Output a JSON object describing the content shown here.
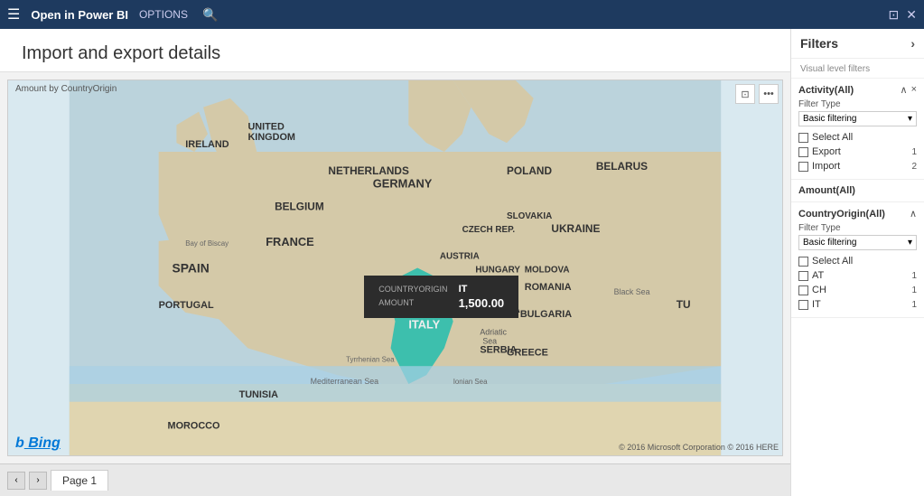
{
  "titleBar": {
    "appName": "Open in Power BI",
    "options": "OPTIONS",
    "searchIcon": "🔍",
    "windowControls": [
      "⊡",
      "×"
    ]
  },
  "pageTitle": "Import and export details",
  "mapLabel": "Amount by CountryOrigin",
  "mapControls": {
    "expandIcon": "⊡",
    "moreIcon": "..."
  },
  "tooltip": {
    "countryOriginLabel": "COUNTRYORIGIN",
    "countryOriginValue": "IT",
    "amountLabel": "AMOUNT",
    "amountValue": "1,500.00"
  },
  "bingLogo": "b̲ Bing",
  "copyright": "© 2016 Microsoft Corporation  © 2016 HERE",
  "pageNav": {
    "prevBtn": "‹",
    "nextBtn": "›",
    "pageTab": "Page 1"
  },
  "filters": {
    "title": "Filters",
    "arrowIcon": "›",
    "visualLevelLabel": "Visual level filters",
    "cards": [
      {
        "id": "activity",
        "title": "Activity(All)",
        "upIcon": "^",
        "closeIcon": "×",
        "filterTypeLabel": "Filter Type",
        "filterTypeValue": "Basic filtering",
        "items": [
          {
            "label": "Select All",
            "count": "",
            "checked": false
          },
          {
            "label": "Export",
            "count": "1",
            "checked": false
          },
          {
            "label": "Import",
            "count": "2",
            "checked": false
          }
        ]
      },
      {
        "id": "amount",
        "title": "Amount(All)",
        "items": []
      },
      {
        "id": "countryOrigin",
        "title": "CountryOrigin(All)",
        "upIcon": "^",
        "filterTypeLabel": "Filter Type",
        "filterTypeValue": "Basic filtering",
        "items": [
          {
            "label": "Select All",
            "count": "",
            "checked": false
          },
          {
            "label": "AT",
            "count": "1",
            "checked": false
          },
          {
            "label": "CH",
            "count": "1",
            "checked": false
          },
          {
            "label": "IT",
            "count": "1",
            "checked": false
          }
        ]
      }
    ]
  },
  "mapCountries": {
    "highlighted": "IT",
    "highlightColor": "#3dbfad"
  }
}
